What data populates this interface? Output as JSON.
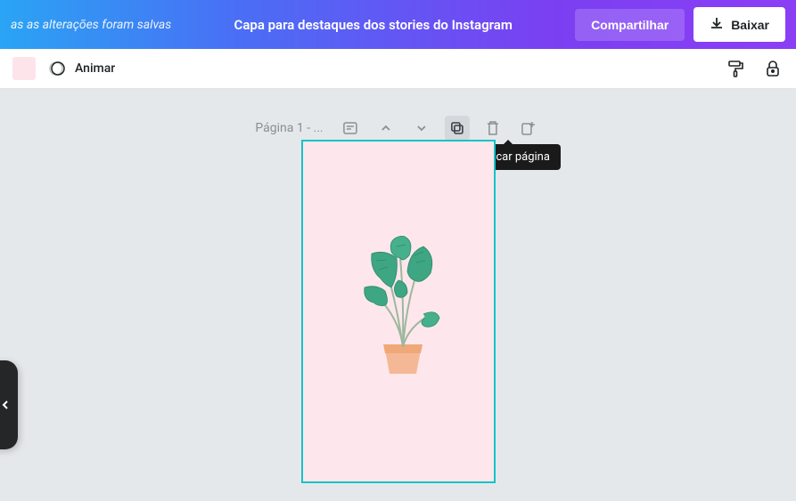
{
  "header": {
    "save_status": "as as alterações foram salvas",
    "title": "Capa para destaques dos stories do Instagram",
    "share_label": "Compartilhar",
    "download_label": "Baixar"
  },
  "toolbar": {
    "animate_label": "Animar",
    "color_swatch": "#fde4ea"
  },
  "page": {
    "label": "Página 1 - ...",
    "tooltip_duplicate": "Duplicar página"
  }
}
